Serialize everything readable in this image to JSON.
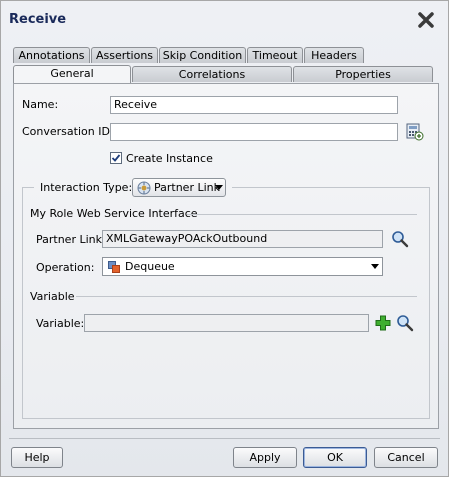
{
  "window": {
    "title": "Receive"
  },
  "tabs": {
    "row1": [
      "Annotations",
      "Assertions",
      "Skip Condition",
      "Timeout",
      "Headers"
    ],
    "row2": [
      "General",
      "Correlations",
      "Properties"
    ],
    "active": "General"
  },
  "form": {
    "name_label": "Name:",
    "name_value": "Receive",
    "conversation_label": "Conversation ID:",
    "conversation_value": "",
    "create_instance_label": "Create Instance",
    "create_instance_checked": true,
    "interaction_type_label": "Interaction Type:",
    "interaction_type_value": "Partner Link",
    "my_role_label": "My Role Web Service Interface",
    "partner_link_label": "Partner Link:",
    "partner_link_value": "XMLGatewayPOAckOutbound",
    "operation_label": "Operation:",
    "operation_value": "Dequeue",
    "variable_group_label": "Variable",
    "variable_label": "Variable:",
    "variable_value": ""
  },
  "buttons": {
    "help": "Help",
    "apply": "Apply",
    "ok": "OK",
    "cancel": "Cancel"
  },
  "icons": {
    "close": "close-x-icon",
    "conversation": "generate-id-icon",
    "partner_link_search": "search-icon",
    "operation": "operation-icon",
    "variable_add": "add-icon",
    "variable_search": "search-icon"
  },
  "colors": {
    "title": "#1a2a5a",
    "accent_border": "#3b5b94"
  }
}
